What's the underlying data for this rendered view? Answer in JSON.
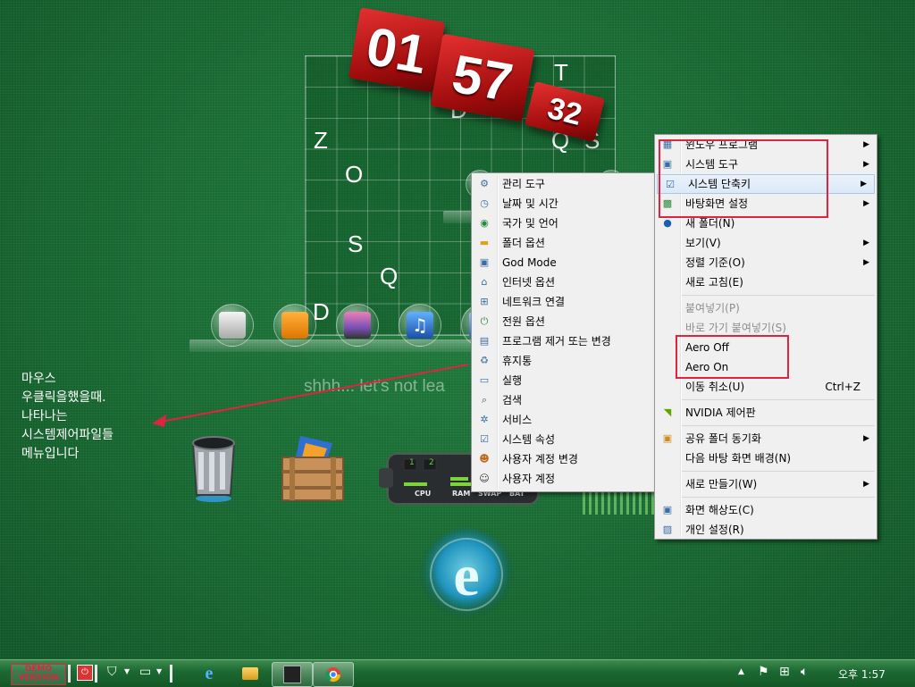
{
  "desktop": {
    "grid_letters": [
      "T",
      "D",
      "Z",
      "Q",
      "S",
      "O",
      "S",
      "Q",
      "D"
    ],
    "clock": {
      "hours": "01",
      "minutes": "57",
      "seconds": "32"
    },
    "shhh_text": "shhh... let's not lea"
  },
  "annotation": {
    "lines": [
      "마우스",
      "우클릭을했을때.",
      "나타나는",
      "시스템제어파일들",
      "메뉴입니다"
    ]
  },
  "submenu": {
    "items": [
      {
        "label": "관리 도구",
        "icon": "admin-tools-icon"
      },
      {
        "label": "날짜 및 시간",
        "icon": "clock-icon"
      },
      {
        "label": "국가 및 언어",
        "icon": "globe-icon"
      },
      {
        "label": "폴더 옵션",
        "icon": "folder-icon"
      },
      {
        "label": "God Mode",
        "icon": "control-panel-icon"
      },
      {
        "label": "인터넷 옵션",
        "icon": "internet-options-icon"
      },
      {
        "label": "네트워크 연결",
        "icon": "network-icon"
      },
      {
        "label": "전원 옵션",
        "icon": "power-icon"
      },
      {
        "label": "프로그램 제거 또는 변경",
        "icon": "programs-icon"
      },
      {
        "label": "휴지통",
        "icon": "recycle-bin-icon"
      },
      {
        "label": "실행",
        "icon": "run-icon"
      },
      {
        "label": "검색",
        "icon": "search-icon"
      },
      {
        "label": "서비스",
        "icon": "gear-icon"
      },
      {
        "label": "시스템 속성",
        "icon": "system-properties-icon"
      },
      {
        "label": "사용자 계정 변경",
        "icon": "user-switch-icon"
      },
      {
        "label": "사용자 계정",
        "icon": "user-icon"
      }
    ]
  },
  "context_menu": {
    "items": [
      {
        "label": "윈도우 프로그램",
        "arrow": true
      },
      {
        "label": "시스템 도구",
        "arrow": true
      },
      {
        "label": "시스템 단축키",
        "arrow": true,
        "highlight": true
      },
      {
        "label": "바탕화면 설정",
        "arrow": true
      },
      {
        "label": "새 폴더(N)"
      },
      {
        "label": "보기(V)",
        "arrow": true
      },
      {
        "label": "정렬 기준(O)",
        "arrow": true
      },
      {
        "label": "새로 고침(E)"
      },
      {
        "label": "붙여넣기(P)",
        "disabled": true
      },
      {
        "label": "바로 가기 붙여넣기(S)",
        "disabled": true
      },
      {
        "label": "Aero Off"
      },
      {
        "label": "Aero On"
      },
      {
        "label": "이동 취소(U)",
        "shortcut": "Ctrl+Z"
      },
      {
        "label": "NVIDIA 제어판"
      },
      {
        "label": "공유 폴더 동기화",
        "arrow": true
      },
      {
        "label": "다음 바탕 화면 배경(N)"
      },
      {
        "label": "새로 만들기(W)",
        "arrow": true
      },
      {
        "label": "화면 해상도(C)"
      },
      {
        "label": "개인 설정(R)"
      }
    ]
  },
  "taskbar": {
    "demo_badge": "DEMO VERSION",
    "clock": "오후 1:57"
  },
  "meter_labels": [
    "CPU",
    "RAM",
    "SWAP",
    "BAT"
  ],
  "meter_numbers": [
    "1",
    "2"
  ],
  "colors": {
    "accent_red": "#e0243f",
    "desktop_green": "#16652f"
  }
}
